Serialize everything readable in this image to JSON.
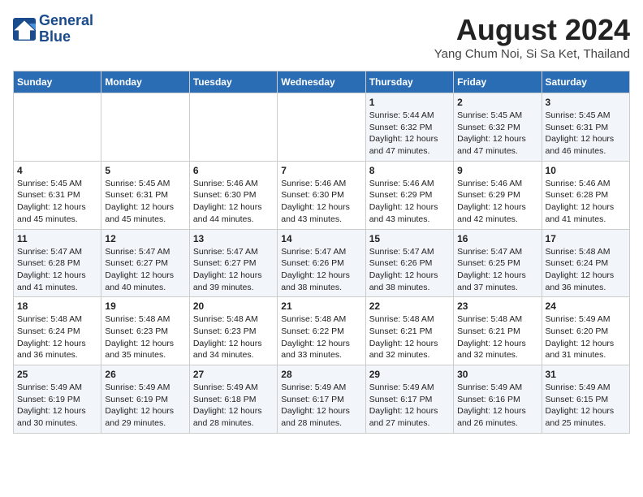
{
  "header": {
    "logo_line1": "General",
    "logo_line2": "Blue",
    "month_title": "August 2024",
    "location": "Yang Chum Noi, Si Sa Ket, Thailand"
  },
  "weekdays": [
    "Sunday",
    "Monday",
    "Tuesday",
    "Wednesday",
    "Thursday",
    "Friday",
    "Saturday"
  ],
  "weeks": [
    [
      {
        "day": "",
        "info": ""
      },
      {
        "day": "",
        "info": ""
      },
      {
        "day": "",
        "info": ""
      },
      {
        "day": "",
        "info": ""
      },
      {
        "day": "1",
        "info": "Sunrise: 5:44 AM\nSunset: 6:32 PM\nDaylight: 12 hours and 47 minutes."
      },
      {
        "day": "2",
        "info": "Sunrise: 5:45 AM\nSunset: 6:32 PM\nDaylight: 12 hours and 47 minutes."
      },
      {
        "day": "3",
        "info": "Sunrise: 5:45 AM\nSunset: 6:31 PM\nDaylight: 12 hours and 46 minutes."
      }
    ],
    [
      {
        "day": "4",
        "info": "Sunrise: 5:45 AM\nSunset: 6:31 PM\nDaylight: 12 hours and 45 minutes."
      },
      {
        "day": "5",
        "info": "Sunrise: 5:45 AM\nSunset: 6:31 PM\nDaylight: 12 hours and 45 minutes."
      },
      {
        "day": "6",
        "info": "Sunrise: 5:46 AM\nSunset: 6:30 PM\nDaylight: 12 hours and 44 minutes."
      },
      {
        "day": "7",
        "info": "Sunrise: 5:46 AM\nSunset: 6:30 PM\nDaylight: 12 hours and 43 minutes."
      },
      {
        "day": "8",
        "info": "Sunrise: 5:46 AM\nSunset: 6:29 PM\nDaylight: 12 hours and 43 minutes."
      },
      {
        "day": "9",
        "info": "Sunrise: 5:46 AM\nSunset: 6:29 PM\nDaylight: 12 hours and 42 minutes."
      },
      {
        "day": "10",
        "info": "Sunrise: 5:46 AM\nSunset: 6:28 PM\nDaylight: 12 hours and 41 minutes."
      }
    ],
    [
      {
        "day": "11",
        "info": "Sunrise: 5:47 AM\nSunset: 6:28 PM\nDaylight: 12 hours and 41 minutes."
      },
      {
        "day": "12",
        "info": "Sunrise: 5:47 AM\nSunset: 6:27 PM\nDaylight: 12 hours and 40 minutes."
      },
      {
        "day": "13",
        "info": "Sunrise: 5:47 AM\nSunset: 6:27 PM\nDaylight: 12 hours and 39 minutes."
      },
      {
        "day": "14",
        "info": "Sunrise: 5:47 AM\nSunset: 6:26 PM\nDaylight: 12 hours and 38 minutes."
      },
      {
        "day": "15",
        "info": "Sunrise: 5:47 AM\nSunset: 6:26 PM\nDaylight: 12 hours and 38 minutes."
      },
      {
        "day": "16",
        "info": "Sunrise: 5:47 AM\nSunset: 6:25 PM\nDaylight: 12 hours and 37 minutes."
      },
      {
        "day": "17",
        "info": "Sunrise: 5:48 AM\nSunset: 6:24 PM\nDaylight: 12 hours and 36 minutes."
      }
    ],
    [
      {
        "day": "18",
        "info": "Sunrise: 5:48 AM\nSunset: 6:24 PM\nDaylight: 12 hours and 36 minutes."
      },
      {
        "day": "19",
        "info": "Sunrise: 5:48 AM\nSunset: 6:23 PM\nDaylight: 12 hours and 35 minutes."
      },
      {
        "day": "20",
        "info": "Sunrise: 5:48 AM\nSunset: 6:23 PM\nDaylight: 12 hours and 34 minutes."
      },
      {
        "day": "21",
        "info": "Sunrise: 5:48 AM\nSunset: 6:22 PM\nDaylight: 12 hours and 33 minutes."
      },
      {
        "day": "22",
        "info": "Sunrise: 5:48 AM\nSunset: 6:21 PM\nDaylight: 12 hours and 32 minutes."
      },
      {
        "day": "23",
        "info": "Sunrise: 5:48 AM\nSunset: 6:21 PM\nDaylight: 12 hours and 32 minutes."
      },
      {
        "day": "24",
        "info": "Sunrise: 5:49 AM\nSunset: 6:20 PM\nDaylight: 12 hours and 31 minutes."
      }
    ],
    [
      {
        "day": "25",
        "info": "Sunrise: 5:49 AM\nSunset: 6:19 PM\nDaylight: 12 hours and 30 minutes."
      },
      {
        "day": "26",
        "info": "Sunrise: 5:49 AM\nSunset: 6:19 PM\nDaylight: 12 hours and 29 minutes."
      },
      {
        "day": "27",
        "info": "Sunrise: 5:49 AM\nSunset: 6:18 PM\nDaylight: 12 hours and 28 minutes."
      },
      {
        "day": "28",
        "info": "Sunrise: 5:49 AM\nSunset: 6:17 PM\nDaylight: 12 hours and 28 minutes."
      },
      {
        "day": "29",
        "info": "Sunrise: 5:49 AM\nSunset: 6:17 PM\nDaylight: 12 hours and 27 minutes."
      },
      {
        "day": "30",
        "info": "Sunrise: 5:49 AM\nSunset: 6:16 PM\nDaylight: 12 hours and 26 minutes."
      },
      {
        "day": "31",
        "info": "Sunrise: 5:49 AM\nSunset: 6:15 PM\nDaylight: 12 hours and 25 minutes."
      }
    ]
  ]
}
